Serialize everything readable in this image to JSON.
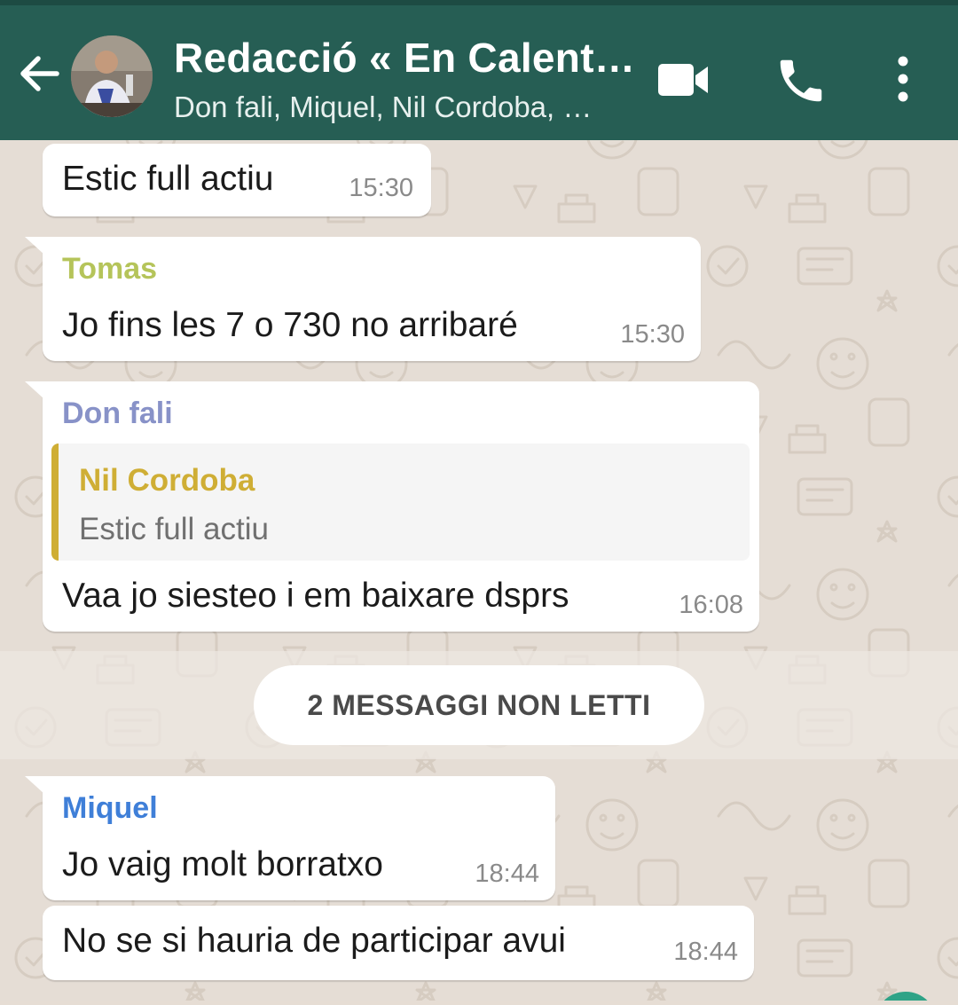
{
  "header": {
    "title": "Redacció « En Calent…",
    "subtitle": "Don fali, Miquel, Nil Cordoba, …",
    "icons": [
      "back-arrow-icon",
      "group-avatar",
      "video-call-icon",
      "phone-icon",
      "more-vert-icon"
    ]
  },
  "colors": {
    "header_bg": "#265e54",
    "chat_bg": "#e5ddd5",
    "tomas": "#b5c45a",
    "don_fali": "#8892c8",
    "nil_cordoba": "#cfae35",
    "miquel": "#3f7fd8"
  },
  "messages": [
    {
      "text": "Estic full actiu",
      "time": "15:30"
    },
    {
      "sender": "Tomas",
      "text": "Jo fins les 7 o 730 no arribaré",
      "time": "15:30"
    },
    {
      "sender": "Don fali",
      "quote": {
        "sender": "Nil Cordoba",
        "text": "Estic full actiu"
      },
      "text": "Vaa jo siesteo i em baixare dsprs",
      "time": "16:08"
    },
    {
      "sender": "Miquel",
      "text": "Jo vaig molt borratxo",
      "time": "18:44"
    },
    {
      "text": "No se si hauria de participar avui",
      "time": "18:44"
    }
  ],
  "unread_divider": "2 MESSAGGI NON LETTI"
}
